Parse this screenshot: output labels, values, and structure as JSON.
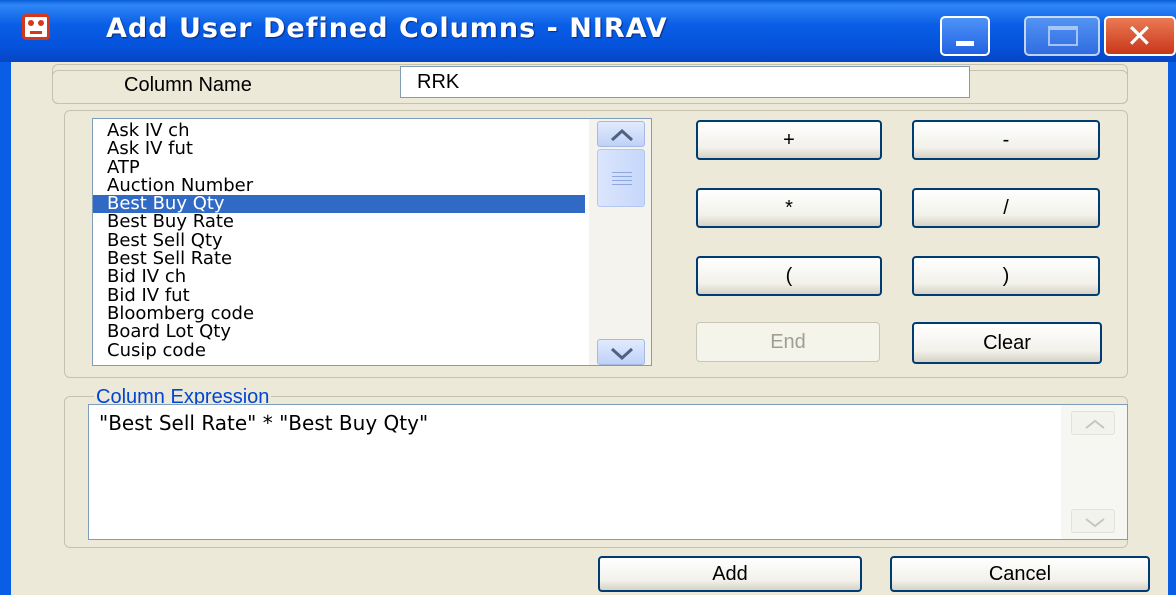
{
  "window": {
    "title": "Add User Defined Columns - NIRAV"
  },
  "column_name": {
    "label": "Column Name",
    "value": "RRK"
  },
  "field_list": {
    "items": [
      "Ask IV ch",
      "Ask IV fut",
      "ATP",
      "Auction Number",
      "Best Buy Qty",
      "Best Buy Rate",
      "Best Sell Qty",
      "Best Sell Rate",
      "Bid IV ch",
      "Bid IV fut",
      "Bloomberg code",
      "Board Lot Qty",
      "Cusip code"
    ],
    "selected": "Best Buy Qty"
  },
  "operators": {
    "plus": "+",
    "minus": "-",
    "multiply": "*",
    "divide": "/",
    "open_paren": "(",
    "close_paren": ")",
    "end": "End",
    "clear": "Clear"
  },
  "expression": {
    "legend": "Column Expression",
    "value": "\"Best Sell Rate\" * \"Best Buy Qty\""
  },
  "footer": {
    "add": "Add",
    "cancel": "Cancel"
  },
  "colors": {
    "title_bar": "#0a5ee6",
    "selection": "#316ac5",
    "legend_text": "#0046d5",
    "dialog_bg": "#ece9d8"
  }
}
